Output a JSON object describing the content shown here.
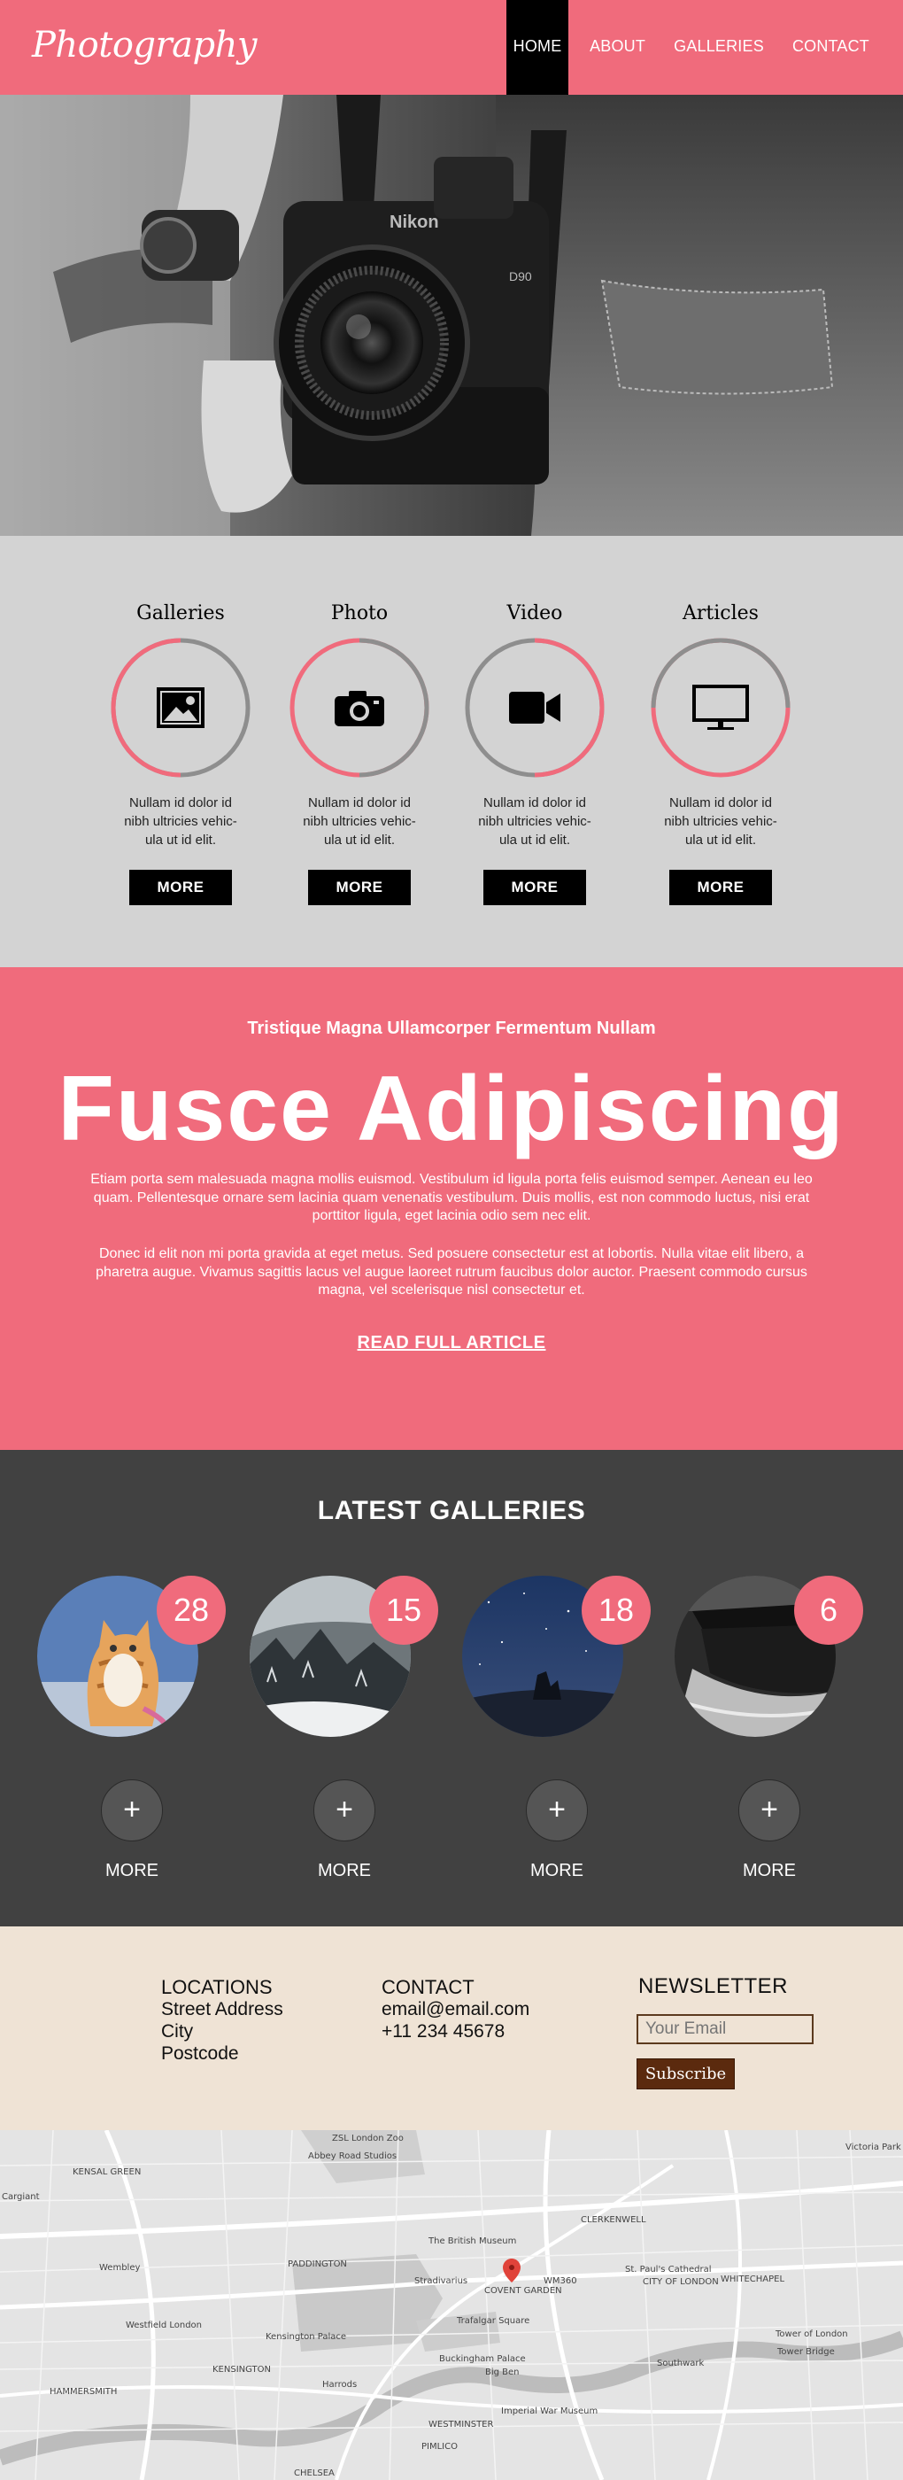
{
  "header": {
    "logo": "Photography",
    "nav": [
      "HOME",
      "ABOUT",
      "GALLERIES",
      "CONTACT"
    ],
    "active": "HOME"
  },
  "hero": {
    "camera_brand": "Nikon",
    "camera_model": "D90"
  },
  "services": [
    {
      "title": "Galleries",
      "icon": "image-icon",
      "text": "Nullam id dolor id nibh ultricies vehic-ula ut id elit.",
      "button": "MORE"
    },
    {
      "title": "Photo",
      "icon": "camera-icon",
      "text": "Nullam id dolor id nibh ultricies vehic-ula ut id elit.",
      "button": "MORE"
    },
    {
      "title": "Video",
      "icon": "video-icon",
      "text": "Nullam id dolor id nibh ultricies vehic-ula ut id elit.",
      "button": "MORE"
    },
    {
      "title": "Articles",
      "icon": "monitor-icon",
      "text": "Nullam id dolor id nibh ultricies vehic-ula ut id elit.",
      "button": "MORE"
    }
  ],
  "article": {
    "subtitle": "Tristique Magna Ullamcorper Fermentum Nullam",
    "title": "Fusce Adipiscing",
    "paragraph1": "Etiam porta sem malesuada magna mollis euismod. Vestibulum id ligula porta felis euismod semper. Aenean eu leo quam. Pellentesque ornare sem lacinia quam venenatis vestibulum. Duis mollis, est non commodo luctus, nisi erat porttitor ligula, eget lacinia odio sem nec elit.",
    "paragraph2": "Donec id elit non mi porta gravida at eget metus. Sed posuere consectetur est at lobortis. Nulla vitae elit libero, a pharetra augue. Vivamus sagittis lacus vel augue laoreet rutrum faucibus dolor auctor. Praesent commodo cursus magna, vel scelerisque nisl consectetur et.",
    "link": "READ FULL ARTICLE"
  },
  "galleries": {
    "title": "LATEST GALLERIES",
    "items": [
      {
        "count": "28",
        "plus": "+",
        "more": "MORE"
      },
      {
        "count": "15",
        "plus": "+",
        "more": "MORE"
      },
      {
        "count": "18",
        "plus": "+",
        "more": "MORE"
      },
      {
        "count": "6",
        "plus": "+",
        "more": "MORE"
      }
    ]
  },
  "footer": {
    "locations": {
      "title": "LOCATIONS",
      "lines": [
        "Street Address",
        "City",
        "Postcode"
      ]
    },
    "contact": {
      "title": "CONTACT",
      "lines": [
        "email@email.com",
        "+11 234 45678"
      ]
    },
    "newsletter": {
      "title": "NEWSLETTER",
      "placeholder": "Your Email",
      "button": "Subscribe"
    }
  },
  "map": {
    "labels": [
      "ZSL London Zoo",
      "Abbey Road Studios",
      "Victoria Park",
      "Cargiant",
      "KENSAL GREEN",
      "CLERKENWELL",
      "The British Museum",
      "PADDINGTON",
      "Stradivarius",
      "WM360",
      "COVENT GARDEN",
      "St. Paul's Cathedral",
      "CITY OF LONDON",
      "WHITECHAPEL",
      "Westfield London",
      "Kensington Palace",
      "Trafalgar Square",
      "Buckingham Palace",
      "Big Ben",
      "KENSINGTON",
      "Harrods",
      "Southwark",
      "Tower of London",
      "Tower Bridge",
      "HAMMERSMITH",
      "Imperial War Museum",
      "WESTMINSTER",
      "PIMLICO",
      "CHELSEA",
      "Wembley"
    ]
  },
  "colors": {
    "accent": "#f06b7c",
    "dark": "#414141",
    "services_bg": "#d3d3d3",
    "footer_bg": "#efe3d5",
    "subscribe": "#5b2a0e"
  }
}
